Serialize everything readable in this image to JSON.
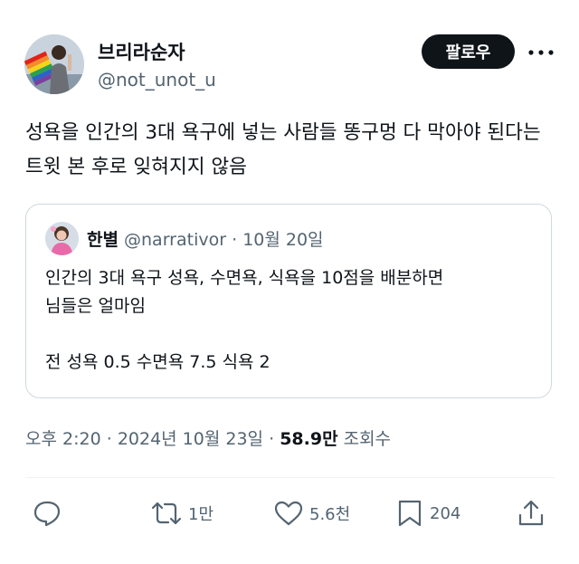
{
  "author": {
    "display_name": "브리라순자",
    "handle": "@not_unot_u",
    "avatar_icon": "profile-photo-rainbow-flag"
  },
  "follow_button": {
    "label": "팔로우"
  },
  "more_icon": "ellipsis-icon",
  "tweet": {
    "text": "성욕을 인간의 3대 욕구에 넣는 사람들 똥구멍 다 막아야 된다는 트윗 본 후로 잊혀지지 않음"
  },
  "quoted_tweet": {
    "display_name": "한별",
    "handle": "@narrativor",
    "separator": "·",
    "date": "10월 20일",
    "lines": [
      "인간의 3대 욕구 성욕, 수면욕, 식욕을 10점을 배분하면",
      "님들은 얼마임",
      "",
      "전 성욕 0.5 수면욕 7.5 식욕 2"
    ]
  },
  "meta": {
    "time": "오후 2:20",
    "separator": "·",
    "date": "2024년 10월 23일",
    "views_count": "58.9만",
    "views_label": "조회수"
  },
  "actions": {
    "reply": {
      "icon": "reply-icon"
    },
    "retweet": {
      "icon": "retweet-icon",
      "count": "1만"
    },
    "like": {
      "icon": "heart-icon",
      "count": "5.6천"
    },
    "bookmark": {
      "icon": "bookmark-icon",
      "count": "204"
    },
    "share": {
      "icon": "share-icon"
    }
  },
  "colors": {
    "text": "#0f1419",
    "secondary": "#536471",
    "border": "#cfd9de",
    "button_bg": "#0f1419"
  }
}
